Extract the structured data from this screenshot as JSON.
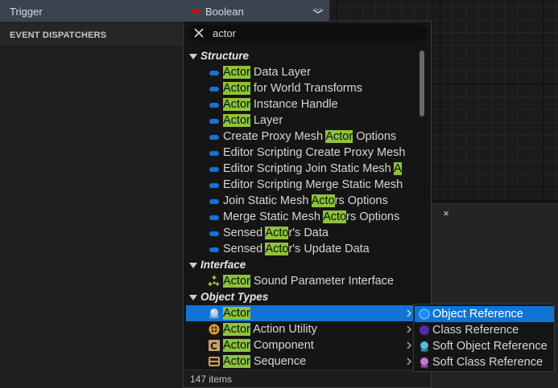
{
  "variable_row": {
    "name": "Trigger",
    "type_label": "Boolean",
    "type_color": "#b01818"
  },
  "section_header": {
    "label": "EVENT DISPATCHERS"
  },
  "lower_tab": {
    "close_glyph": "×"
  },
  "search": {
    "value": "actor",
    "placeholder": ""
  },
  "categories": {
    "structure": "Structure",
    "interface": "Interface",
    "object_types": "Object Types"
  },
  "structure_items": [
    {
      "pre": "",
      "hl": "Actor",
      "post": " Data Layer"
    },
    {
      "pre": "",
      "hl": "Actor",
      "post": " for World Transforms"
    },
    {
      "pre": "",
      "hl": "Actor",
      "post": " Instance Handle"
    },
    {
      "pre": "",
      "hl": "Actor",
      "post": " Layer"
    },
    {
      "pre": "Create Proxy Mesh ",
      "hl": "Actor",
      "post": " Options"
    },
    {
      "pre": "Editor Scripting Create Proxy Mesh",
      "hl": "",
      "post": ""
    },
    {
      "pre": "Editor Scripting Join Static Mesh ",
      "hl": "A",
      "post": ""
    },
    {
      "pre": "Editor Scripting Merge Static Mesh",
      "hl": "",
      "post": ""
    },
    {
      "pre": "Join Static Mesh ",
      "hl": "Acto",
      "post": "rs Options"
    },
    {
      "pre": "Merge Static Mesh ",
      "hl": "Acto",
      "post": "rs Options"
    },
    {
      "pre": "Sensed ",
      "hl": "Acto",
      "post": "r's Data"
    },
    {
      "pre": "Sensed ",
      "hl": "Acto",
      "post": "r's Update Data"
    }
  ],
  "interface_items": [
    {
      "pre": "",
      "hl": "Actor",
      "post": " Sound Parameter Interface"
    }
  ],
  "object_items": [
    {
      "pre": "",
      "hl": "Actor",
      "post": "",
      "icon": "actor-sphere-icon",
      "selected": true
    },
    {
      "pre": "",
      "hl": "Actor",
      "post": " Action Utility",
      "icon": "action-utility-icon",
      "selected": false
    },
    {
      "pre": "",
      "hl": "Actor",
      "post": " Component",
      "icon": "component-icon",
      "selected": false
    },
    {
      "pre": "",
      "hl": "Actor",
      "post": " Sequence",
      "icon": "sequence-icon",
      "selected": false
    }
  ],
  "footer": {
    "count": "147 items"
  },
  "submenu": [
    {
      "label": "Object Reference",
      "color": "#1a8cff",
      "selected": true
    },
    {
      "label": "Class Reference",
      "color": "#5a2aa8",
      "selected": false
    },
    {
      "label": "Soft Object Reference",
      "color": "#4fc0d6",
      "selected": false
    },
    {
      "label": "Soft Class Reference",
      "color": "#c078d8",
      "selected": false
    }
  ],
  "colors": {
    "highlight": "#8bc43c",
    "selection": "#0f74d6",
    "struct_pin": "#1c6fd4"
  }
}
